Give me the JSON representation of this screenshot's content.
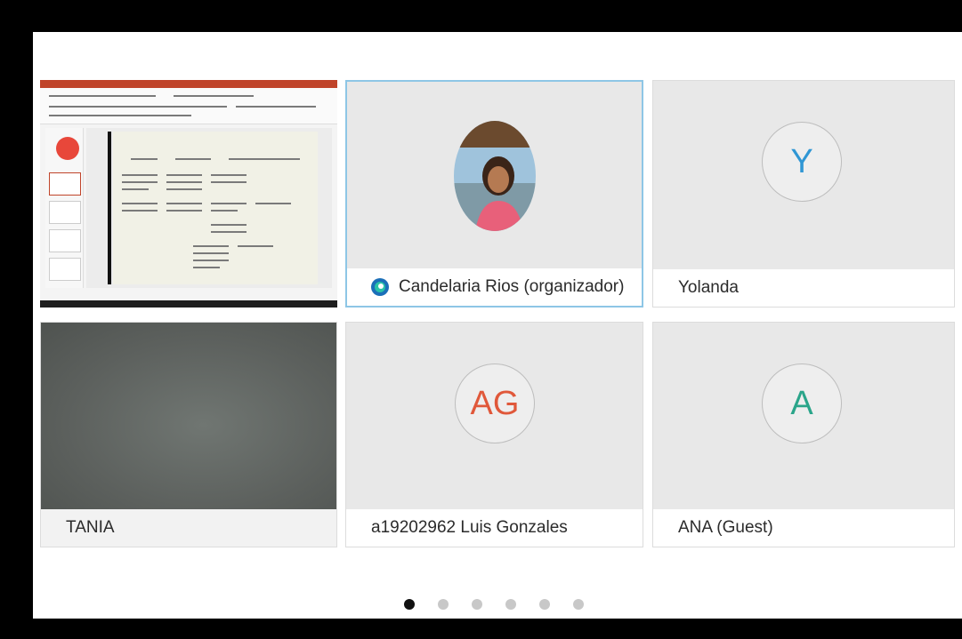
{
  "participants": [
    {
      "name": "",
      "type": "screenshare"
    },
    {
      "name": "Candelaria Rios (organizador)",
      "type": "photo",
      "active": true,
      "icon": "organizer-badge-icon"
    },
    {
      "name": "Yolanda",
      "type": "initials",
      "initials": "Y",
      "color": "#2f96d4"
    },
    {
      "name": "TANIA",
      "type": "video"
    },
    {
      "name": "a19202962 Luis Gonzales",
      "type": "initials",
      "initials": "AG",
      "color": "#e0583a"
    },
    {
      "name": "ANA (Guest)",
      "type": "initials",
      "initials": "A",
      "color": "#2aa58a"
    }
  ],
  "pagination": {
    "pages": 6,
    "current": 1
  },
  "colors": {
    "active_border": "#8ec6e6",
    "ribbon": "#c0442a"
  }
}
